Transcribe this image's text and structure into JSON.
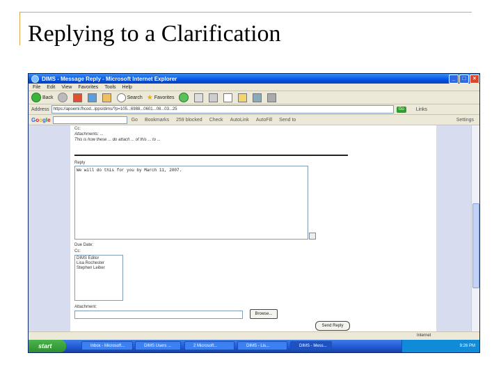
{
  "slide": {
    "title": "Replying to a Clarification"
  },
  "window": {
    "title": "DIMS - Message Reply - Microsoft Internet Explorer",
    "menu": [
      "File",
      "Edit",
      "View",
      "Favorites",
      "Tools",
      "Help"
    ],
    "toolbar": {
      "back": "Back",
      "search": "Search",
      "favorites": "Favorites"
    },
    "address": {
      "label": "Address",
      "url": "https://apoemi.fhcod...ipps/dims/?p=105...6988...0601...08...03...25",
      "go": "Go",
      "links": "Links"
    },
    "google": {
      "logo": "Google",
      "go": "Go",
      "bookmarks": "Bookmarks",
      "blocked": "259 blocked",
      "check": "Check",
      "autolink": "AutoLink",
      "autofill": "AutoFill",
      "sendto": "Send to",
      "settings": "Settings"
    }
  },
  "form": {
    "cc_line": "Cc:",
    "attachment_line": "Attachments: ...",
    "info_line": "This is how these ... do attach ... of this ... to ...",
    "reply_label": "Reply",
    "reply_text": "We will do this for you by March 11, 2007.",
    "date_label": "Due Date:",
    "cc_label": "Cc:",
    "cc_options": [
      "DIMS Editor",
      "Lisa Rochester",
      "Stephen Leiber"
    ],
    "attachment_label": "Attachment:",
    "browse_button": "Browse...",
    "send_button": "Send Reply"
  },
  "status": {
    "zone": "Internet"
  },
  "taskbar": {
    "start": "start",
    "tasks": [
      "Inbox - Microsoft...",
      "DIMS Users ...",
      "2 Microsoft...",
      "DIMS - Lis...",
      "DIMS - Mess..."
    ],
    "clock": "9:26 PM"
  }
}
